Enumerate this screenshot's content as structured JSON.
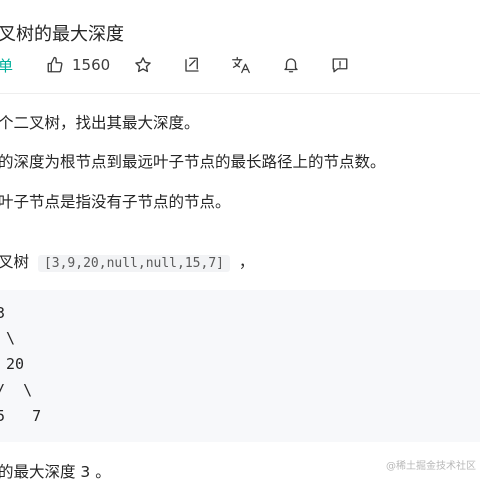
{
  "problem": {
    "title": "叉树的最大深度",
    "difficulty": "单",
    "likes": "1560"
  },
  "toolbar": {
    "icons": [
      "thumbs-up-icon",
      "star-icon",
      "share-icon",
      "translate-icon",
      "bell-icon",
      "feedback-icon"
    ]
  },
  "description": {
    "p1": "个二叉树，找出其最大深度。",
    "p2": "的深度为根节点到最远叶子节点的最长路径上的节点数。",
    "p3": "叶子节点是指没有子节点的节点。",
    "example_prefix": "叉树",
    "example_code": "[3,9,20,null,null,15,7]",
    "example_suffix": "，"
  },
  "tree": {
    "line1": "3",
    "line2": "\\",
    "line3": "20",
    "line4": "/  \\",
    "line5": "5   7"
  },
  "answer": {
    "text": "的最大深度 3 。"
  },
  "watermark": "@稀土掘金技术社区",
  "colors": {
    "difficulty": "#00af9b",
    "code_bg": "#f7f8fa",
    "inline_code_bg": "#f2f3f5"
  }
}
